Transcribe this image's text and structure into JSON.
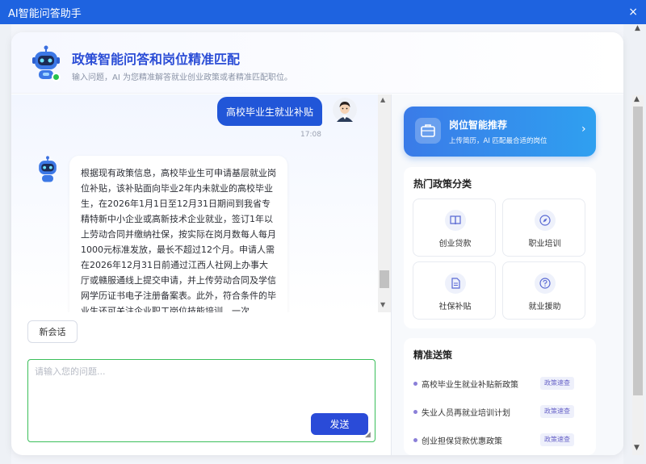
{
  "window": {
    "title": "AI智能问答助手",
    "close_glyph": "×"
  },
  "header": {
    "title": "政策智能问答和岗位精准匹配",
    "subtitle": "输入问题，AI 为您精准解答就业创业政策或者精准匹配职位。"
  },
  "chat": {
    "user_message": "高校毕业生就业补贴",
    "user_time": "17:08",
    "bot_message": "根据现有政策信息，高校毕业生可申请基层就业岗位补贴，该补贴面向毕业2年内未就业的高校毕业生，在2026年1月1日至12月31日期间到我省专精特新中小企业或高新技术企业就业，签订1年以上劳动合同并缴纳社保，按实际在岗月数每人每月1000元标准发放，最长不超过12个月。申请人需在2026年12月31日前通过江西人社网上办事大厅或赣服通线上提交申请，并上传劳动合同及学信网学历证书电子注册备案表。此外，符合条件的毕业生还可关注企业职工岗位技能培训、一次"
  },
  "composer": {
    "new_chat_label": "新会话",
    "placeholder": "请输入您的问题...",
    "send_label": "发送"
  },
  "job_card": {
    "title": "岗位智能推荐",
    "subtitle": "上传简历，AI 匹配最合适的岗位"
  },
  "categories": {
    "title": "热门政策分类",
    "items": [
      {
        "label": "创业贷款",
        "icon": "book-icon"
      },
      {
        "label": "职业培训",
        "icon": "compass-icon"
      },
      {
        "label": "社保补贴",
        "icon": "document-icon"
      },
      {
        "label": "就业援助",
        "icon": "question-icon"
      }
    ]
  },
  "recommend": {
    "title": "精准送策",
    "items": [
      {
        "text": "高校毕业生就业补贴新政策",
        "tag": "政策速查"
      },
      {
        "text": "失业人员再就业培训计划",
        "tag": "政策速查"
      },
      {
        "text": "创业担保贷款优惠政策",
        "tag": "政策速查"
      }
    ]
  },
  "colors": {
    "titlebar": "#1e63e0",
    "brand": "#2b4dd6",
    "user_bubble": "#2156d8",
    "send_button": "#2a4bd8",
    "input_border": "#3bbf5a"
  }
}
